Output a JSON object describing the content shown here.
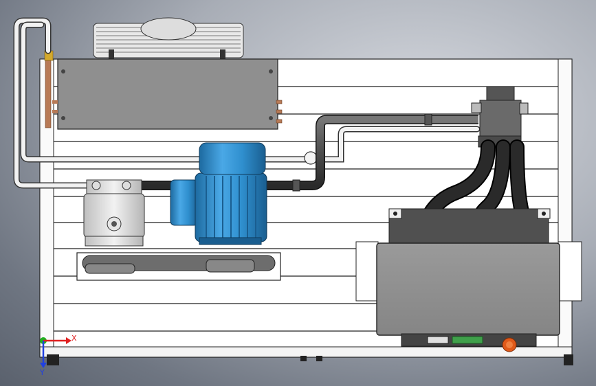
{
  "axis_triad": {
    "x_label": "X",
    "y_label": "Y"
  },
  "colors": {
    "motor_blue": "#2f8fce",
    "pipe_dark": "#3a3a3a",
    "pipe_white": "#f2f2f2",
    "copper": "#b87a56",
    "brass": "#d4a92c",
    "panel_gray": "#8c8c8c",
    "hose_black": "#1b1b1b",
    "emergency_stop": "#e05a1a",
    "axis_x": "#e02020",
    "axis_y": "#20b020",
    "axis_z": "#2040e0"
  },
  "icons": {
    "triad": "xyz-triad-icon"
  }
}
